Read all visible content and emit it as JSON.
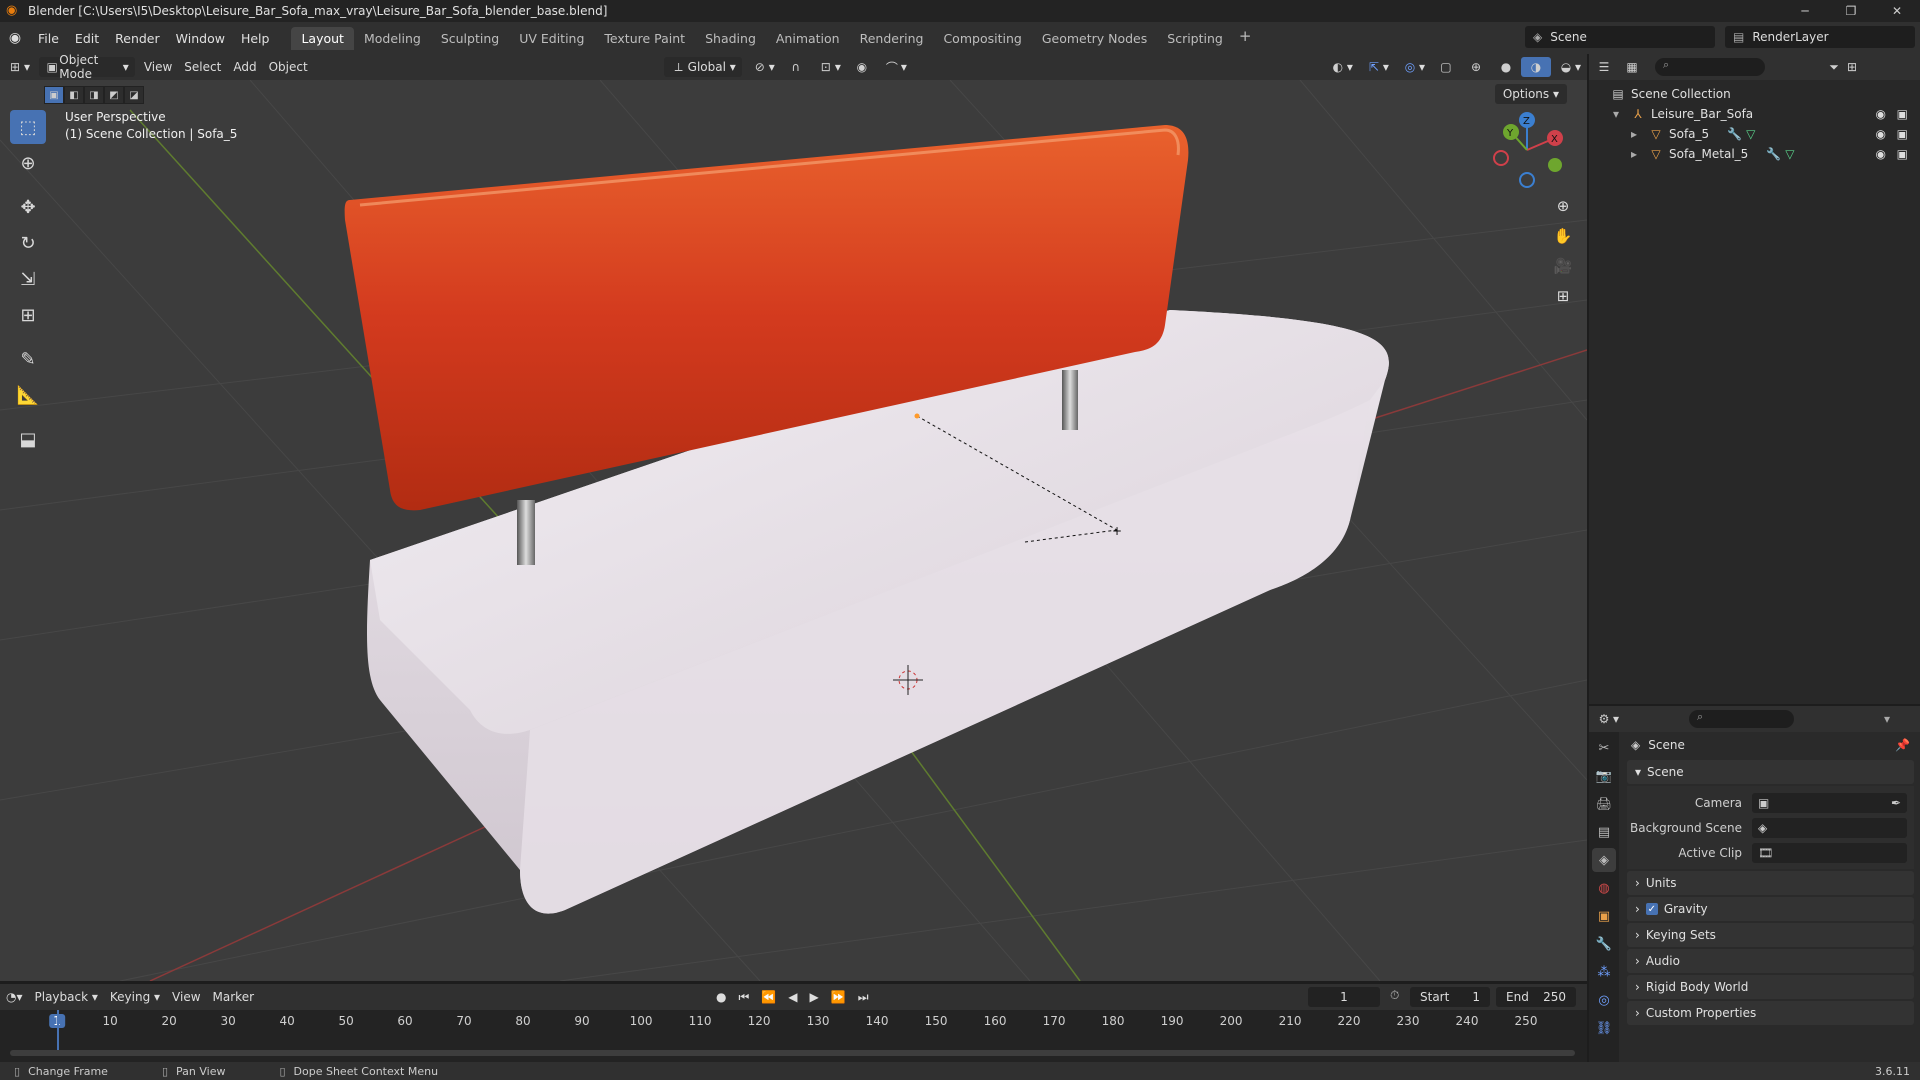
{
  "window": {
    "title": "Blender [C:\\Users\\I5\\Desktop\\Leisure_Bar_Sofa_max_vray\\Leisure_Bar_Sofa_blender_base.blend]",
    "version": "3.6.11"
  },
  "menu": [
    "File",
    "Edit",
    "Render",
    "Window",
    "Help"
  ],
  "workspaces": [
    "Layout",
    "Modeling",
    "Sculpting",
    "UV Editing",
    "Texture Paint",
    "Shading",
    "Animation",
    "Rendering",
    "Compositing",
    "Geometry Nodes",
    "Scripting"
  ],
  "active_workspace": "Layout",
  "scene_name": "Scene",
  "view_layer": "RenderLayer",
  "viewport_header": {
    "mode": "Object Mode",
    "menus": [
      "View",
      "Select",
      "Add",
      "Object"
    ],
    "orientation": "Global",
    "options_label": "Options"
  },
  "viewport": {
    "perspective_label": "User Perspective",
    "collection_label": "(1) Scene Collection | Sofa_5",
    "gizmo": {
      "z": "Z",
      "y": "Y",
      "x": "X"
    }
  },
  "outliner": {
    "root": "Scene Collection",
    "items": [
      {
        "name": "Leisure_Bar_Sofa",
        "level": 1
      },
      {
        "name": "Sofa_5",
        "level": 2
      },
      {
        "name": "Sofa_Metal_5",
        "level": 2
      }
    ]
  },
  "properties": {
    "context_title": "Scene",
    "panel_scene": "Scene",
    "fields": [
      {
        "label": "Camera",
        "value": ""
      },
      {
        "label": "Background Scene",
        "value": ""
      },
      {
        "label": "Active Clip",
        "value": ""
      }
    ],
    "panels": [
      "Units",
      "Gravity",
      "Keying Sets",
      "Audio",
      "Rigid Body World",
      "Custom Properties"
    ],
    "gravity_checked": true
  },
  "timeline": {
    "menus": [
      "Playback",
      "Keying",
      "View",
      "Marker"
    ],
    "current_frame": "1",
    "start_label": "Start",
    "start": "1",
    "end_label": "End",
    "end": "250",
    "ticks": [
      "1",
      "10",
      "20",
      "30",
      "40",
      "50",
      "60",
      "70",
      "80",
      "90",
      "100",
      "110",
      "120",
      "130",
      "140",
      "150",
      "160",
      "170",
      "180",
      "190",
      "200",
      "210",
      "220",
      "230",
      "240",
      "250"
    ]
  },
  "status_bar": [
    "Change Frame",
    "Pan View",
    "Dope Sheet Context Menu"
  ]
}
